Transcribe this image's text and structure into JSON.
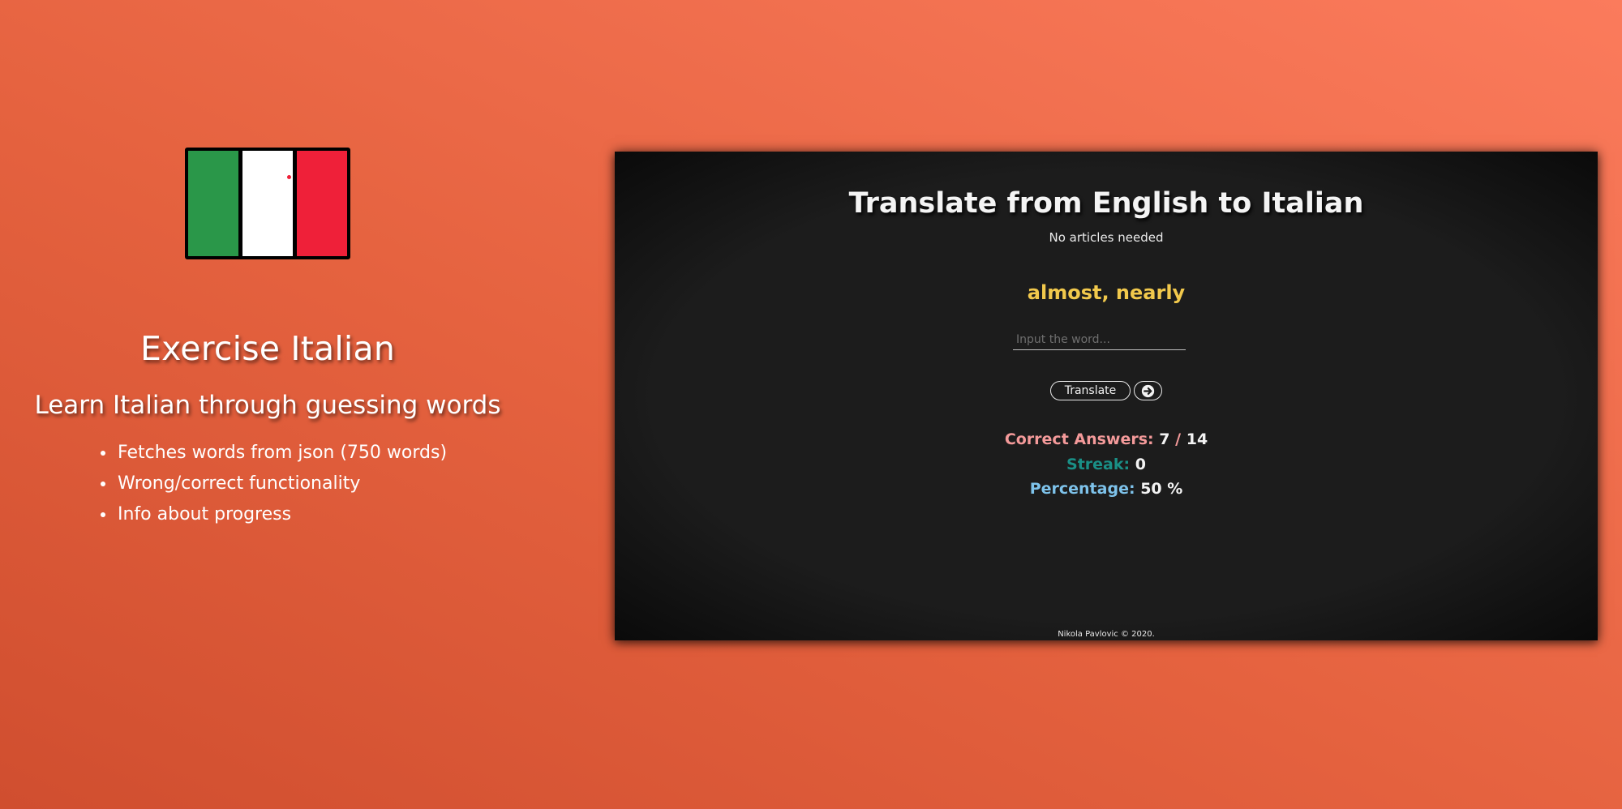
{
  "promo": {
    "title": "Exercise Italian",
    "subtitle": "Learn Italian through guessing words",
    "features": [
      "Fetches words from json (750 words)",
      "Wrong/correct functionality",
      "Info about progress"
    ],
    "flag_colors": {
      "green": "#2a9749",
      "white": "#ffffff",
      "red": "#ef2039"
    }
  },
  "app": {
    "title": "Translate from English to Italian",
    "note": "No articles needed",
    "prompt_word": "almost, nearly",
    "input": {
      "value": "",
      "placeholder": "Input the word..."
    },
    "buttons": {
      "translate_label": "Translate",
      "next_icon": "arrow-right-circle-icon"
    },
    "stats": {
      "correct_label": "Correct Answers:",
      "correct_value": "7",
      "correct_separator": "/",
      "correct_total": "14",
      "streak_label": "Streak:",
      "streak_value": "0",
      "percent_label": "Percentage:",
      "percent_value": "50 %"
    },
    "footer": "Nikola Pavlovic © 2020."
  },
  "colors": {
    "background_start": "#d04e2f",
    "background_end": "#fb7b5c",
    "panel": "#1c1c1c",
    "prompt_word": "#f2c94c",
    "correct_label": "#f49a9a",
    "streak_label": "#1a8f86",
    "percent_label": "#7ec3eb"
  }
}
